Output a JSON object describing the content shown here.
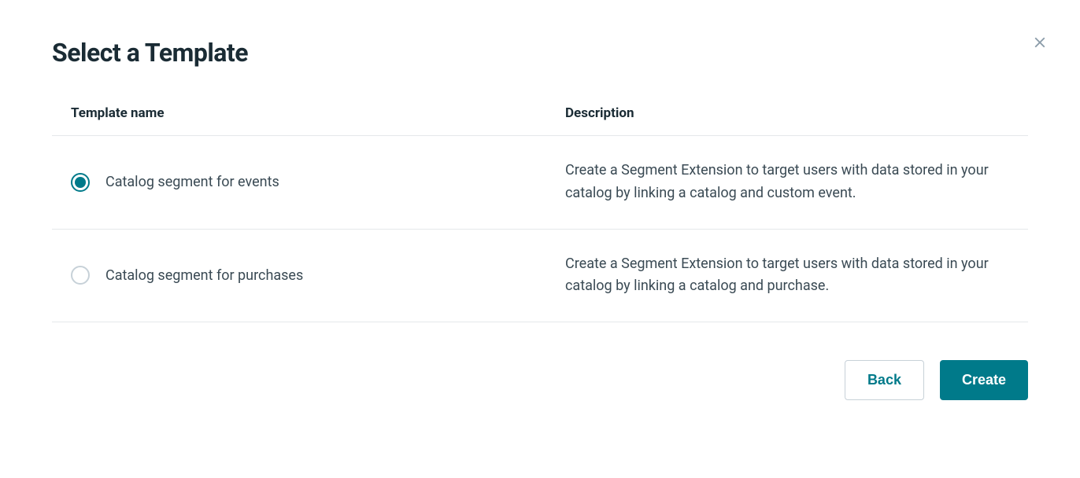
{
  "modal": {
    "title": "Select a Template",
    "columns": {
      "name": "Template name",
      "description": "Description"
    },
    "rows": [
      {
        "label": "Catalog segment for events",
        "description": "Create a Segment Extension to target users with data stored in your catalog by linking a catalog and custom event.",
        "selected": true
      },
      {
        "label": "Catalog segment for purchases",
        "description": "Create a Segment Extension to target users with data stored in your catalog by linking a catalog and purchase.",
        "selected": false
      }
    ],
    "buttons": {
      "back": "Back",
      "create": "Create"
    }
  }
}
